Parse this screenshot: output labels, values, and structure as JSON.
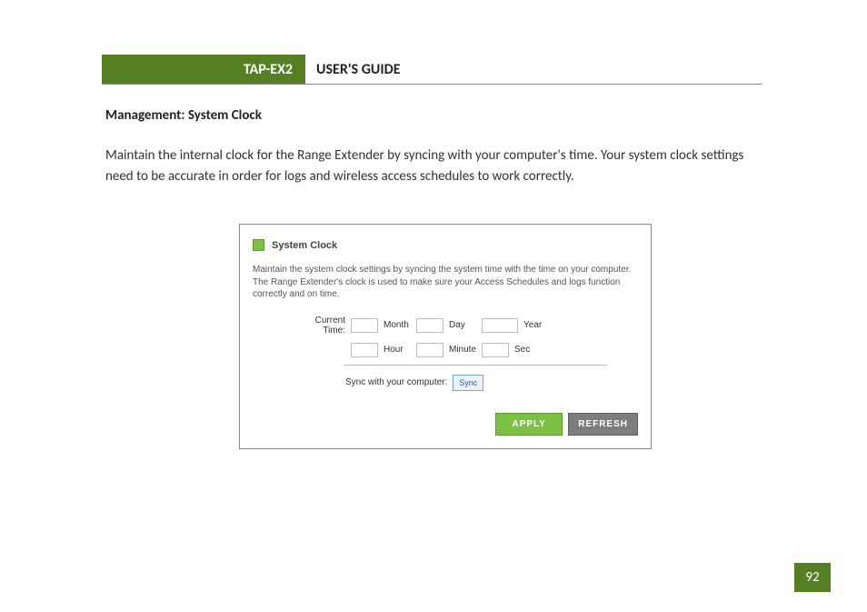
{
  "header": {
    "product": "TAP-EX2",
    "title": "USER'S GUIDE"
  },
  "section": {
    "title": "Management: System Clock",
    "body": "Maintain the internal clock for the Range Extender by syncing with your computer's time. Your system clock settings need to be accurate in order for logs and wireless access schedules to work correctly."
  },
  "panel": {
    "title": "System Clock",
    "description": "Maintain the system clock settings by syncing the system time with the time on your computer. The Range Extender's clock is used to make sure your Access Schedules and logs function correctly and on time.",
    "current_time_label": "Current Time:",
    "fields": {
      "month": "Month",
      "day": "Day",
      "year": "Year",
      "hour": "Hour",
      "minute": "Minute",
      "sec": "Sec"
    },
    "sync_label": "Sync with your computer:",
    "sync_button": "Sync",
    "apply": "APPLY",
    "refresh": "REFRESH"
  },
  "page_number": "92"
}
